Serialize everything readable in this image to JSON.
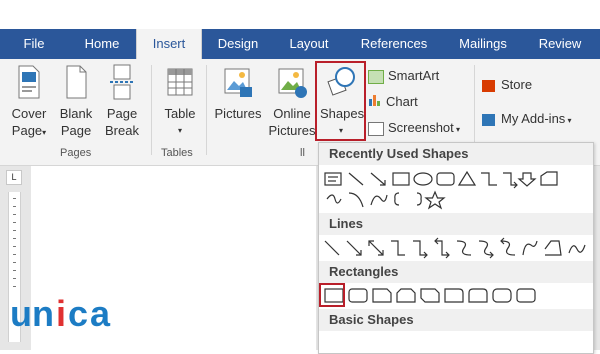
{
  "tabs": [
    {
      "label": "File"
    },
    {
      "label": "Home"
    },
    {
      "label": "Insert"
    },
    {
      "label": "Design"
    },
    {
      "label": "Layout"
    },
    {
      "label": "References"
    },
    {
      "label": "Mailings"
    },
    {
      "label": "Review"
    }
  ],
  "active_tab": "Insert",
  "ribbon": {
    "cover_page_line1": "Cover",
    "cover_page_line2": "Page",
    "blank_page_line1": "Blank",
    "blank_page_line2": "Page",
    "page_break_line1": "Page",
    "page_break_line2": "Break",
    "pages_group": "Pages",
    "table_label": "Table",
    "tables_group": "Tables",
    "pictures_label": "Pictures",
    "online_pictures_line1": "Online",
    "online_pictures_line2": "Pictures",
    "shapes_label": "Shapes",
    "smartart_label": "SmartArt",
    "chart_label": "Chart",
    "screenshot_label": "Screenshot",
    "store_label": "Store",
    "addins_label": "My Add-ins"
  },
  "ruler": {
    "corner": "L"
  },
  "dropdown": {
    "sections": [
      {
        "title": "Recently Used Shapes"
      },
      {
        "title": "Lines"
      },
      {
        "title": "Rectangles"
      },
      {
        "title": "Basic Shapes"
      }
    ]
  },
  "logo": {
    "text": "unica"
  },
  "colors": {
    "tab_bar": "#2b579a",
    "highlight": "#b91f2a",
    "logo_blue": "#1c7cc4",
    "logo_red": "#e03131"
  }
}
